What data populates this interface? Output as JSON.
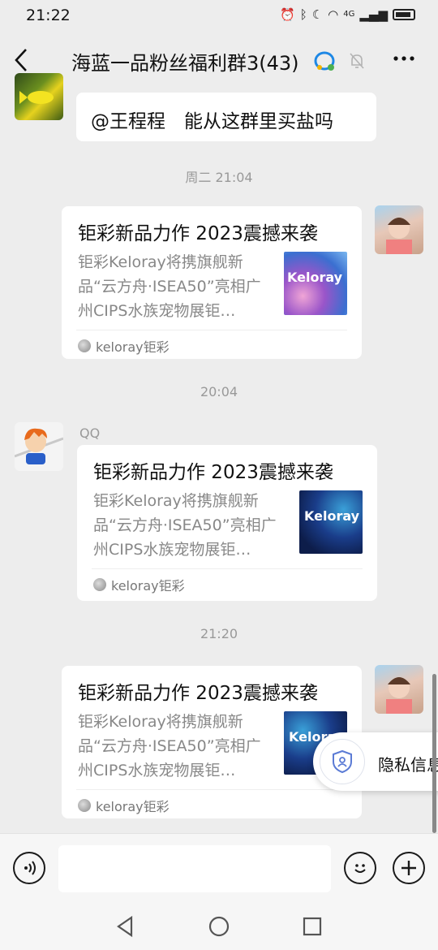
{
  "status": {
    "time": "21:22",
    "network": "4G"
  },
  "header": {
    "title": "海蓝一品粉丝福利群3(43)"
  },
  "messages": [
    {
      "text": "@王程程　能从这群里买盐吗"
    },
    {
      "time": "周二 21:04",
      "title": "钜彩新品力作 2023震撼来袭",
      "desc": "钜彩Keloray将携旗舰新品“云方舟·ISEA50”亮相广州CIPS水族宠物展钜…",
      "source": "keloray钜彩",
      "thumb_text": "Keloray"
    },
    {
      "time": "20:04",
      "sender": "QQ",
      "title": "钜彩新品力作 2023震撼来袭",
      "desc": "钜彩Keloray将携旗舰新品“云方舟·ISEA50”亮相广州CIPS水族宠物展钜…",
      "source": "keloray钜彩",
      "thumb_text": "Keloray"
    },
    {
      "time": "21:20",
      "title": "钜彩新品力作 2023震撼来袭",
      "desc": "钜彩Keloray将携旗舰新品“云方舟·ISEA50”亮相广州CIPS水族宠物展钜…",
      "source": "keloray钜彩",
      "thumb_text": "Keloray"
    }
  ],
  "privacy": {
    "label": "隐私信息"
  },
  "colors": {
    "background": "#ededed",
    "bubble": "#ffffff",
    "timestamp": "#999999"
  }
}
